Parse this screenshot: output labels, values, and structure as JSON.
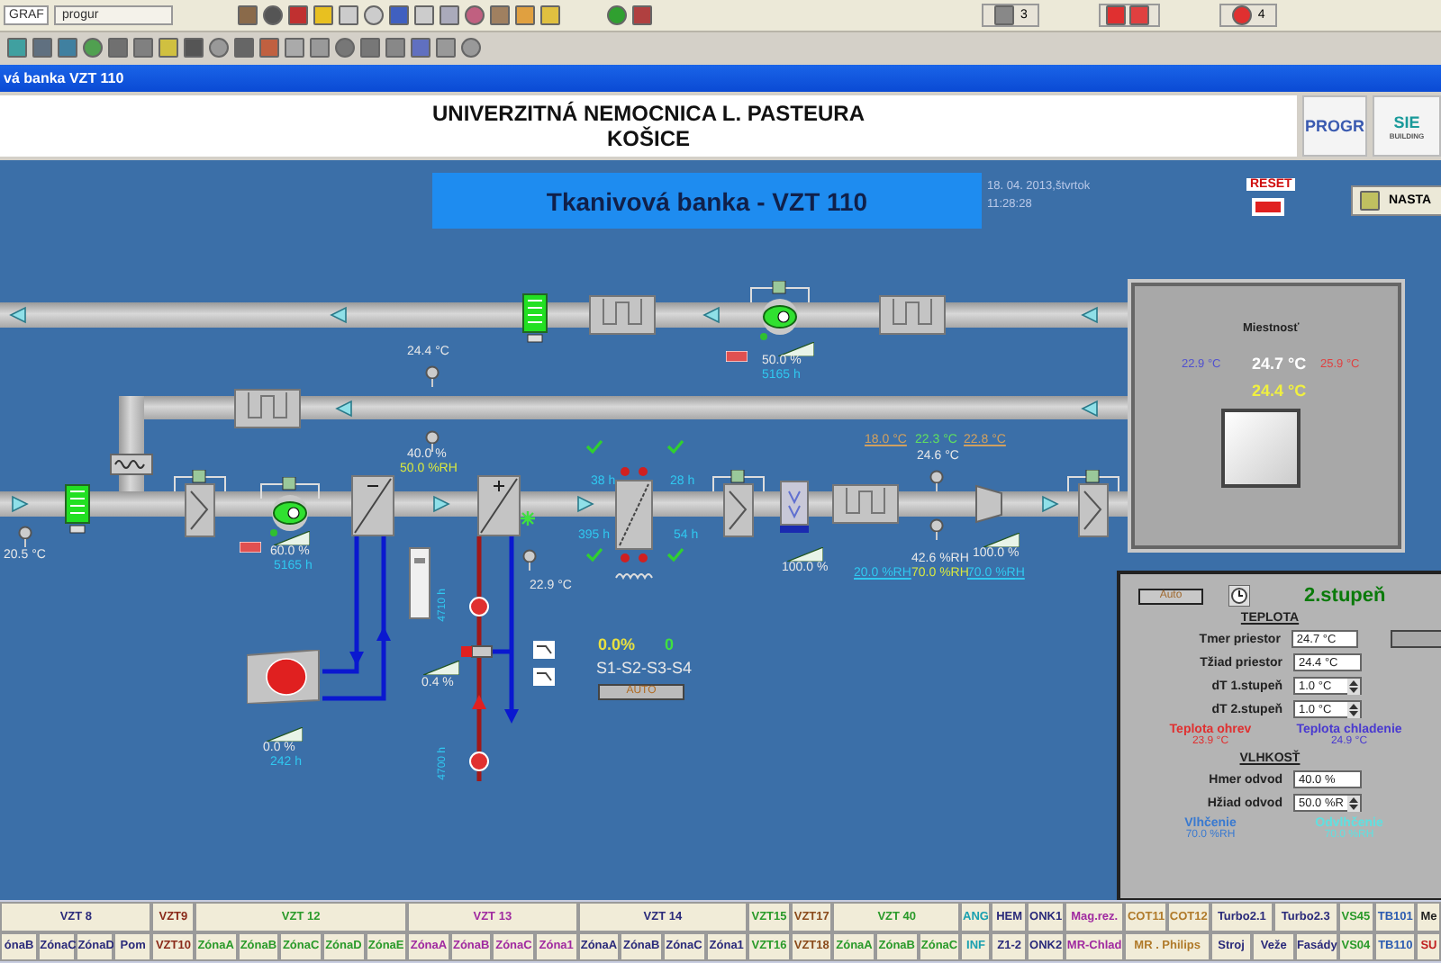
{
  "toolbar": {
    "app_label": "GRAF",
    "user_field": "progur",
    "counter_a": "3",
    "counter_b": "4"
  },
  "window": {
    "title": "vá banka VZT 110"
  },
  "header": {
    "line1": "UNIVERZITNÁ NEMOCNICA L. PASTEURA",
    "line2": "KOŠICE",
    "logo1": "PROGR",
    "logo2": "SIE",
    "logo2_sub": "BUILDING"
  },
  "screen": {
    "title": "Tkanivová banka - VZT 110",
    "date": "18. 04. 2013,štvrtok",
    "time": "11:28:28",
    "reset": "RESET",
    "settings": "NASTA"
  },
  "diagram": {
    "outdoor_temp": "20.5 °C",
    "supply_fan": {
      "output": "60.0 %",
      "hours": "5165 h"
    },
    "exhaust_fan": {
      "output": "50.0 %",
      "hours": "5165 h"
    },
    "return_temp": "24.4 °C",
    "return_humidity": "40.0 %",
    "humidity_setpoint": "50.0 %RH",
    "heater_temp": "22.9 °C",
    "exchanger_hours": [
      "38 h",
      "28 h",
      "395 h",
      "54 h"
    ],
    "supply_temps": [
      "18.0 °C",
      "22.3 °C",
      "22.8 °C"
    ],
    "supply_temp": "24.6 °C",
    "humidifier_output": "100.0 %",
    "supply_humidity": "42.6 %RH",
    "damper_output": "100.0 %",
    "humidity_limits": [
      "20.0 %RH",
      "70.0 %RH",
      "70.0 %RH"
    ],
    "cooler": {
      "output": "0.0 %",
      "hours": "242 h"
    },
    "pump_hours": [
      "4710 h",
      "4700 h"
    ],
    "valve_output": "0.4 %",
    "stages": {
      "output": "0.0%",
      "count": "0",
      "label": "S1-S2-S3-S4",
      "mode": "AUTO"
    }
  },
  "room": {
    "title": "Miestnosť",
    "min": "22.9 °C",
    "actual": "24.7 °C",
    "max": "25.9 °C",
    "setpoint": "24.4 °C"
  },
  "panel": {
    "mode": "Auto",
    "stage": "2.stupeň",
    "temp_title": "TEPLOTA",
    "temp_rows": [
      {
        "label": "Tmer priestor",
        "value": "24.7 °C",
        "kind": "readout"
      },
      {
        "label": "Tžiad priestor",
        "value": "24.4 °C",
        "kind": "readout"
      },
      {
        "label": "dT 1.stupeň",
        "value": "1.0 °C",
        "kind": "spinner"
      },
      {
        "label": "dT 2.stupeň",
        "value": "1.0 °C",
        "kind": "spinner"
      }
    ],
    "heating_label": "Teplota ohrev",
    "heating_value": "23.9 °C",
    "cooling_label": "Teplota chladenie",
    "cooling_value": "24.9 °C",
    "hum_title": "VLHKOSŤ",
    "hum_rows": [
      {
        "label": "Hmer odvod",
        "value": "40.0 %",
        "kind": "readout"
      },
      {
        "label": "Hžiad odvod",
        "value": "50.0 %R",
        "kind": "spinner"
      }
    ],
    "humidify_label": "Vlhčenie",
    "humidify_value": "70.0 %RH",
    "dehumidify_label": "Odvlhčenie",
    "dehumidify_value": "70.0 %RH"
  },
  "nav": [
    {
      "top": [
        {
          "label": "VZT 8",
          "color": "#2a2a7a"
        }
      ],
      "bottom": [
        {
          "label": "ónaB",
          "color": "#2a2a7a"
        },
        {
          "label": "ZónaC",
          "color": "#2a2a7a"
        },
        {
          "label": "ZónaD",
          "color": "#2a2a7a"
        },
        {
          "label": "Pom",
          "color": "#2a2a7a"
        }
      ]
    },
    {
      "top": [
        {
          "label": "VZT9",
          "color": "#8a2a1a"
        }
      ],
      "bottom": [
        {
          "label": "VZT10",
          "color": "#8a2a1a"
        }
      ]
    },
    {
      "top": [
        {
          "label": "VZT 12",
          "color": "#2a9a2a"
        }
      ],
      "bottom": [
        {
          "label": "ZónaA",
          "color": "#2a9a2a"
        },
        {
          "label": "ZónaB",
          "color": "#2a9a2a"
        },
        {
          "label": "ZónaC",
          "color": "#2a9a2a"
        },
        {
          "label": "ZónaD",
          "color": "#2a9a2a"
        },
        {
          "label": "ZónaE",
          "color": "#2a9a2a"
        }
      ]
    },
    {
      "top": [
        {
          "label": "VZT 13",
          "color": "#a02aa0"
        }
      ],
      "bottom": [
        {
          "label": "ZónaA",
          "color": "#a02aa0"
        },
        {
          "label": "ZónaB",
          "color": "#a02aa0"
        },
        {
          "label": "ZónaC",
          "color": "#a02aa0"
        },
        {
          "label": "Zóna1",
          "color": "#a02aa0"
        }
      ]
    },
    {
      "top": [
        {
          "label": "VZT 14",
          "color": "#2a2a7a"
        }
      ],
      "bottom": [
        {
          "label": "ZónaA",
          "color": "#2a2a7a"
        },
        {
          "label": "ZónaB",
          "color": "#2a2a7a"
        },
        {
          "label": "ZónaC",
          "color": "#2a2a7a"
        },
        {
          "label": "Zóna1",
          "color": "#2a2a7a"
        }
      ]
    },
    {
      "top": [
        {
          "label": "VZT15",
          "color": "#2a9a2a"
        }
      ],
      "bottom": [
        {
          "label": "VZT16",
          "color": "#2a9a2a"
        }
      ]
    },
    {
      "top": [
        {
          "label": "VZT17",
          "color": "#8a4a1a"
        }
      ],
      "bottom": [
        {
          "label": "VZT18",
          "color": "#8a4a1a"
        }
      ]
    },
    {
      "top": [
        {
          "label": "VZT 40",
          "color": "#2a9a2a"
        }
      ],
      "bottom": [
        {
          "label": "ZónaA",
          "color": "#2a9a2a"
        },
        {
          "label": "ZónaB",
          "color": "#2a9a2a"
        },
        {
          "label": "ZónaC",
          "color": "#2a9a2a"
        }
      ]
    },
    {
      "top": [
        {
          "label": "ANG",
          "color": "#1aa0b0"
        }
      ],
      "bottom": [
        {
          "label": "INF",
          "color": "#1aa0b0"
        }
      ]
    },
    {
      "top": [
        {
          "label": "HEM",
          "color": "#2a2a7a"
        }
      ],
      "bottom": [
        {
          "label": "Z1-2",
          "color": "#2a2a7a"
        }
      ]
    },
    {
      "top": [
        {
          "label": "ONK1",
          "color": "#2a2a7a"
        }
      ],
      "bottom": [
        {
          "label": "ONK2",
          "color": "#2a2a7a"
        }
      ]
    },
    {
      "top": [
        {
          "label": "Mag.rez.",
          "color": "#a02aa0"
        }
      ],
      "bottom": [
        {
          "label": "MR-Chlad",
          "color": "#a02aa0"
        }
      ]
    },
    {
      "top": [
        {
          "label": "COT11",
          "color": "#b07a2a"
        },
        {
          "label": "COT12",
          "color": "#b07a2a"
        }
      ],
      "bottom": [
        {
          "label": "MR . Philips",
          "color": "#b07a2a"
        }
      ]
    },
    {
      "top": [
        {
          "label": "Turbo2.1",
          "color": "#2a2a7a"
        },
        {
          "label": "Turbo2.3",
          "color": "#2a2a7a"
        }
      ],
      "bottom": [
        {
          "label": "Stroj",
          "color": "#2a2a7a"
        },
        {
          "label": "Veže",
          "color": "#2a2a7a"
        },
        {
          "label": "Fasády",
          "color": "#2a2a7a"
        }
      ]
    },
    {
      "top": [
        {
          "label": "VS45",
          "color": "#2a9a2a"
        }
      ],
      "bottom": [
        {
          "label": "VS04",
          "color": "#2a9a2a"
        }
      ]
    },
    {
      "top": [
        {
          "label": "TB101",
          "color": "#2a5ab0"
        }
      ],
      "bottom": [
        {
          "label": "TB110",
          "color": "#2a5ab0"
        }
      ]
    },
    {
      "top": [
        {
          "label": "Me",
          "color": "#222222"
        }
      ],
      "bottom": [
        {
          "label": "SU",
          "color": "#c02020"
        }
      ]
    }
  ]
}
